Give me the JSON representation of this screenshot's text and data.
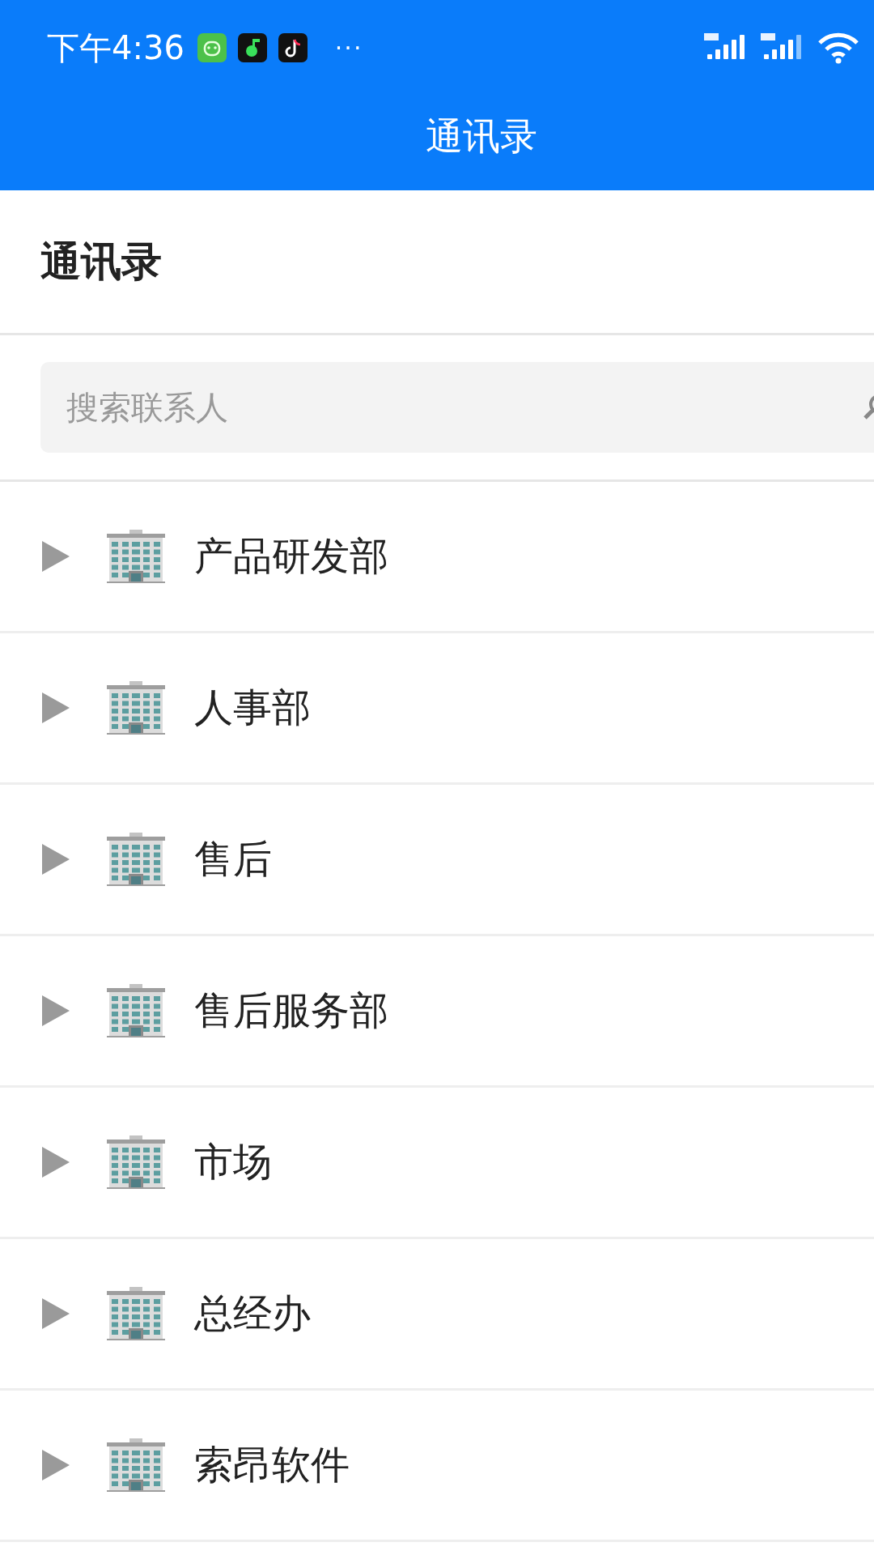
{
  "status_bar": {
    "time": "下午4:36",
    "more": "···"
  },
  "header": {
    "title": "通讯录"
  },
  "section": {
    "title": "通讯录"
  },
  "search": {
    "placeholder": "搜索联系人"
  },
  "departments": [
    {
      "name": "产品研发部",
      "expanded": false
    },
    {
      "name": "人事部",
      "expanded": false
    },
    {
      "name": "售后",
      "expanded": false
    },
    {
      "name": "售后服务部",
      "expanded": false
    },
    {
      "name": "市场",
      "expanded": false
    },
    {
      "name": "总经办",
      "expanded": false
    },
    {
      "name": "索昂软件",
      "expanded": false
    }
  ]
}
